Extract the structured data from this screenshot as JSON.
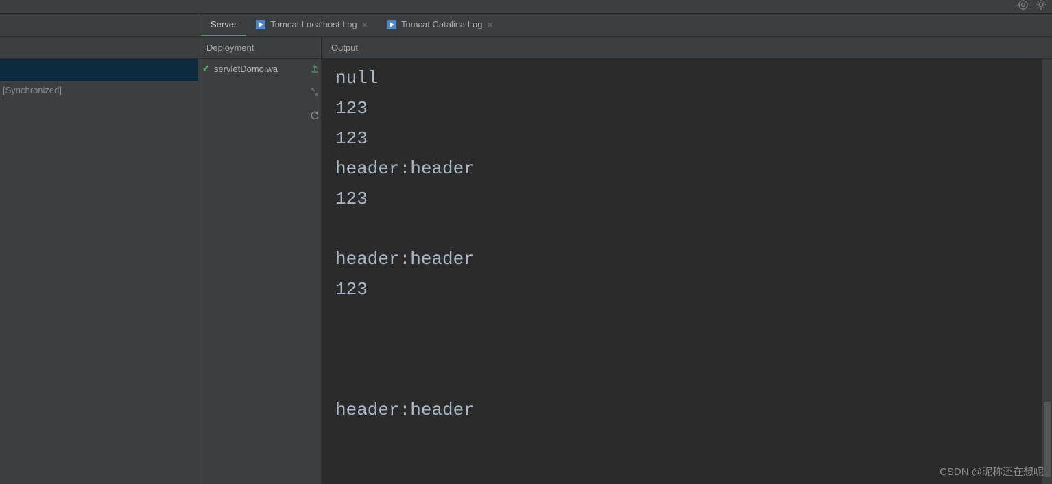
{
  "topbar": {
    "target_icon": "target-icon",
    "gear_icon": "gear-icon"
  },
  "left": {
    "sync_label": "[Synchronized]"
  },
  "tabs": {
    "server": "Server",
    "localhost_log": "Tomcat Localhost Log",
    "catalina_log": "Tomcat Catalina Log"
  },
  "subheader": {
    "deployment": "Deployment",
    "output": "Output"
  },
  "deployment": {
    "item": "servletDomo:wa"
  },
  "console_lines": [
    "null",
    "123",
    "123",
    "header:header",
    "123",
    "",
    "header:header",
    "123",
    "",
    "",
    "",
    "header:header"
  ],
  "watermark": "CSDN @昵称还在想呢"
}
